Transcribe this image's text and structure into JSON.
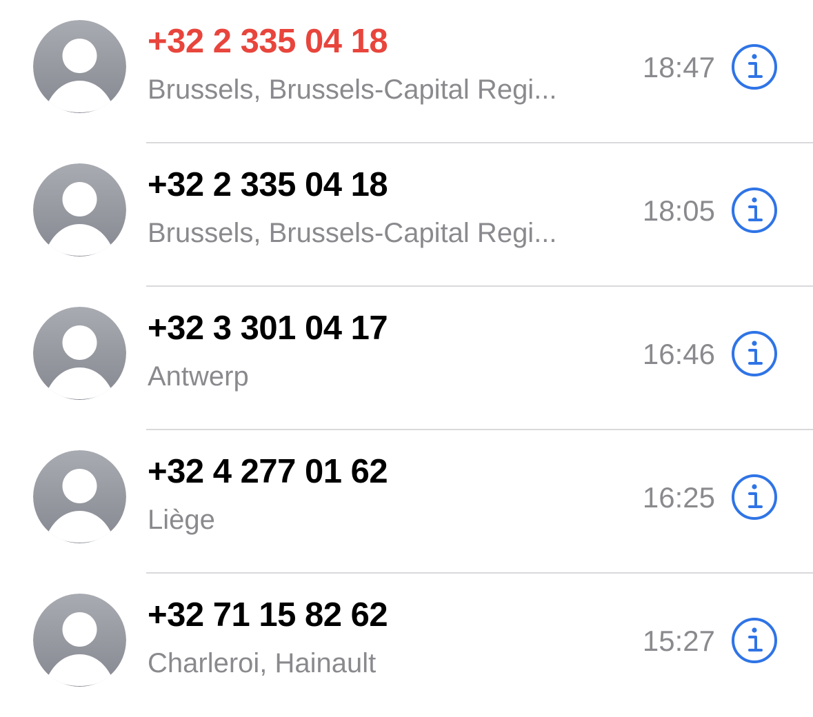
{
  "colors": {
    "missed": "#e8453c",
    "primary_text": "#000000",
    "secondary_text": "#8a8a8e",
    "accent": "#2f74e6",
    "avatar_top": "#a9abb2",
    "avatar_bottom": "#868891",
    "separator": "#d9d9dc"
  },
  "calls": [
    {
      "number": "+32 2 335 04 18",
      "location": "Brussels, Brussels-Capital Regi...",
      "time": "18:47",
      "missed": true,
      "avatar_icon": "person-placeholder-icon",
      "info_icon": "info-circle-icon"
    },
    {
      "number": "+32 2 335 04 18",
      "location": "Brussels, Brussels-Capital Regi...",
      "time": "18:05",
      "missed": false,
      "avatar_icon": "person-placeholder-icon",
      "info_icon": "info-circle-icon"
    },
    {
      "number": "+32 3 301 04 17",
      "location": "Antwerp",
      "time": "16:46",
      "missed": false,
      "avatar_icon": "person-placeholder-icon",
      "info_icon": "info-circle-icon"
    },
    {
      "number": "+32 4 277 01 62",
      "location": "Liège",
      "time": "16:25",
      "missed": false,
      "avatar_icon": "person-placeholder-icon",
      "info_icon": "info-circle-icon"
    },
    {
      "number": "+32 71 15 82 62",
      "location": "Charleroi, Hainault",
      "time": "15:27",
      "missed": false,
      "avatar_icon": "person-placeholder-icon",
      "info_icon": "info-circle-icon"
    }
  ]
}
